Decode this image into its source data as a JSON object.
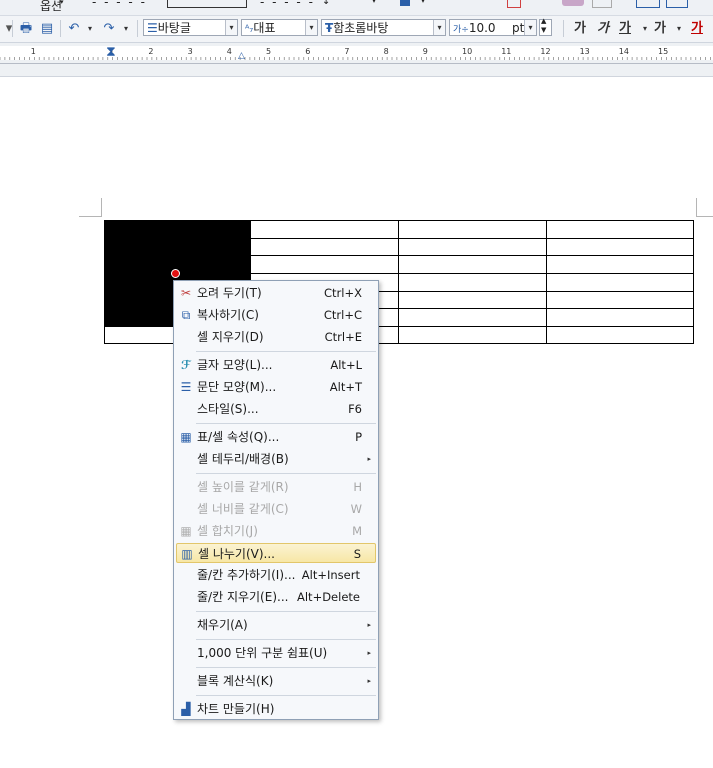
{
  "toolbar_top": {
    "options_label": "옵션",
    "dash_pattern": "- - - - -"
  },
  "toolbar": {
    "style_name": "바탕글",
    "language": "대표",
    "font_name": "함초롬바탕",
    "font_size": "10.0",
    "size_unit": "pt",
    "bold_label": "가",
    "italic_label": "가",
    "underline_label": "가",
    "strike_label": "가",
    "color_label": "가"
  },
  "ruler": {
    "ticks": [
      "2",
      "1",
      "1",
      "2",
      "3",
      "4",
      "5",
      "6",
      "7",
      "8",
      "9",
      "10",
      "11",
      "12",
      "13",
      "14",
      "15"
    ]
  },
  "context_menu": {
    "items": [
      {
        "label": "오려 두기(T)",
        "shortcut": "Ctrl+X",
        "icon": "scissors-icon"
      },
      {
        "label": "복사하기(C)",
        "shortcut": "Ctrl+C",
        "icon": "copy-icon"
      },
      {
        "label": "셀 지우기(D)",
        "shortcut": "Ctrl+E",
        "icon": ""
      },
      {
        "label": "글자 모양(L)...",
        "shortcut": "Alt+L",
        "icon": "char-shape-icon"
      },
      {
        "label": "문단 모양(M)...",
        "shortcut": "Alt+T",
        "icon": "paragraph-shape-icon"
      },
      {
        "label": "스타일(S)...",
        "shortcut": "F6",
        "icon": ""
      },
      {
        "label": "표/셀 속성(Q)...",
        "shortcut": "P",
        "icon": "table-props-icon"
      },
      {
        "label": "셀 테두리/배경(B)",
        "shortcut": "",
        "icon": ""
      },
      {
        "label": "셀 높이를 같게(R)",
        "shortcut": "H",
        "icon": ""
      },
      {
        "label": "셀 너비를 같게(C)",
        "shortcut": "W",
        "icon": ""
      },
      {
        "label": "셀 합치기(J)",
        "shortcut": "M",
        "icon": "merge-cells-icon"
      },
      {
        "label": "셀 나누기(V)...",
        "shortcut": "S",
        "icon": "split-cells-icon"
      },
      {
        "label": "줄/칸 추가하기(I)...",
        "shortcut": "Alt+Insert",
        "icon": ""
      },
      {
        "label": "줄/칸 지우기(E)...",
        "shortcut": "Alt+Delete",
        "icon": ""
      },
      {
        "label": "채우기(A)",
        "shortcut": "",
        "icon": ""
      },
      {
        "label": "1,000 단위 구분 쉼표(U)",
        "shortcut": "",
        "icon": ""
      },
      {
        "label": "블록 계산식(K)",
        "shortcut": "",
        "icon": ""
      },
      {
        "label": "차트 만들기(H)",
        "shortcut": "",
        "icon": "chart-icon"
      }
    ]
  },
  "colors": {
    "highlight": "#f7e7a6",
    "selected_cell": "#000000"
  }
}
